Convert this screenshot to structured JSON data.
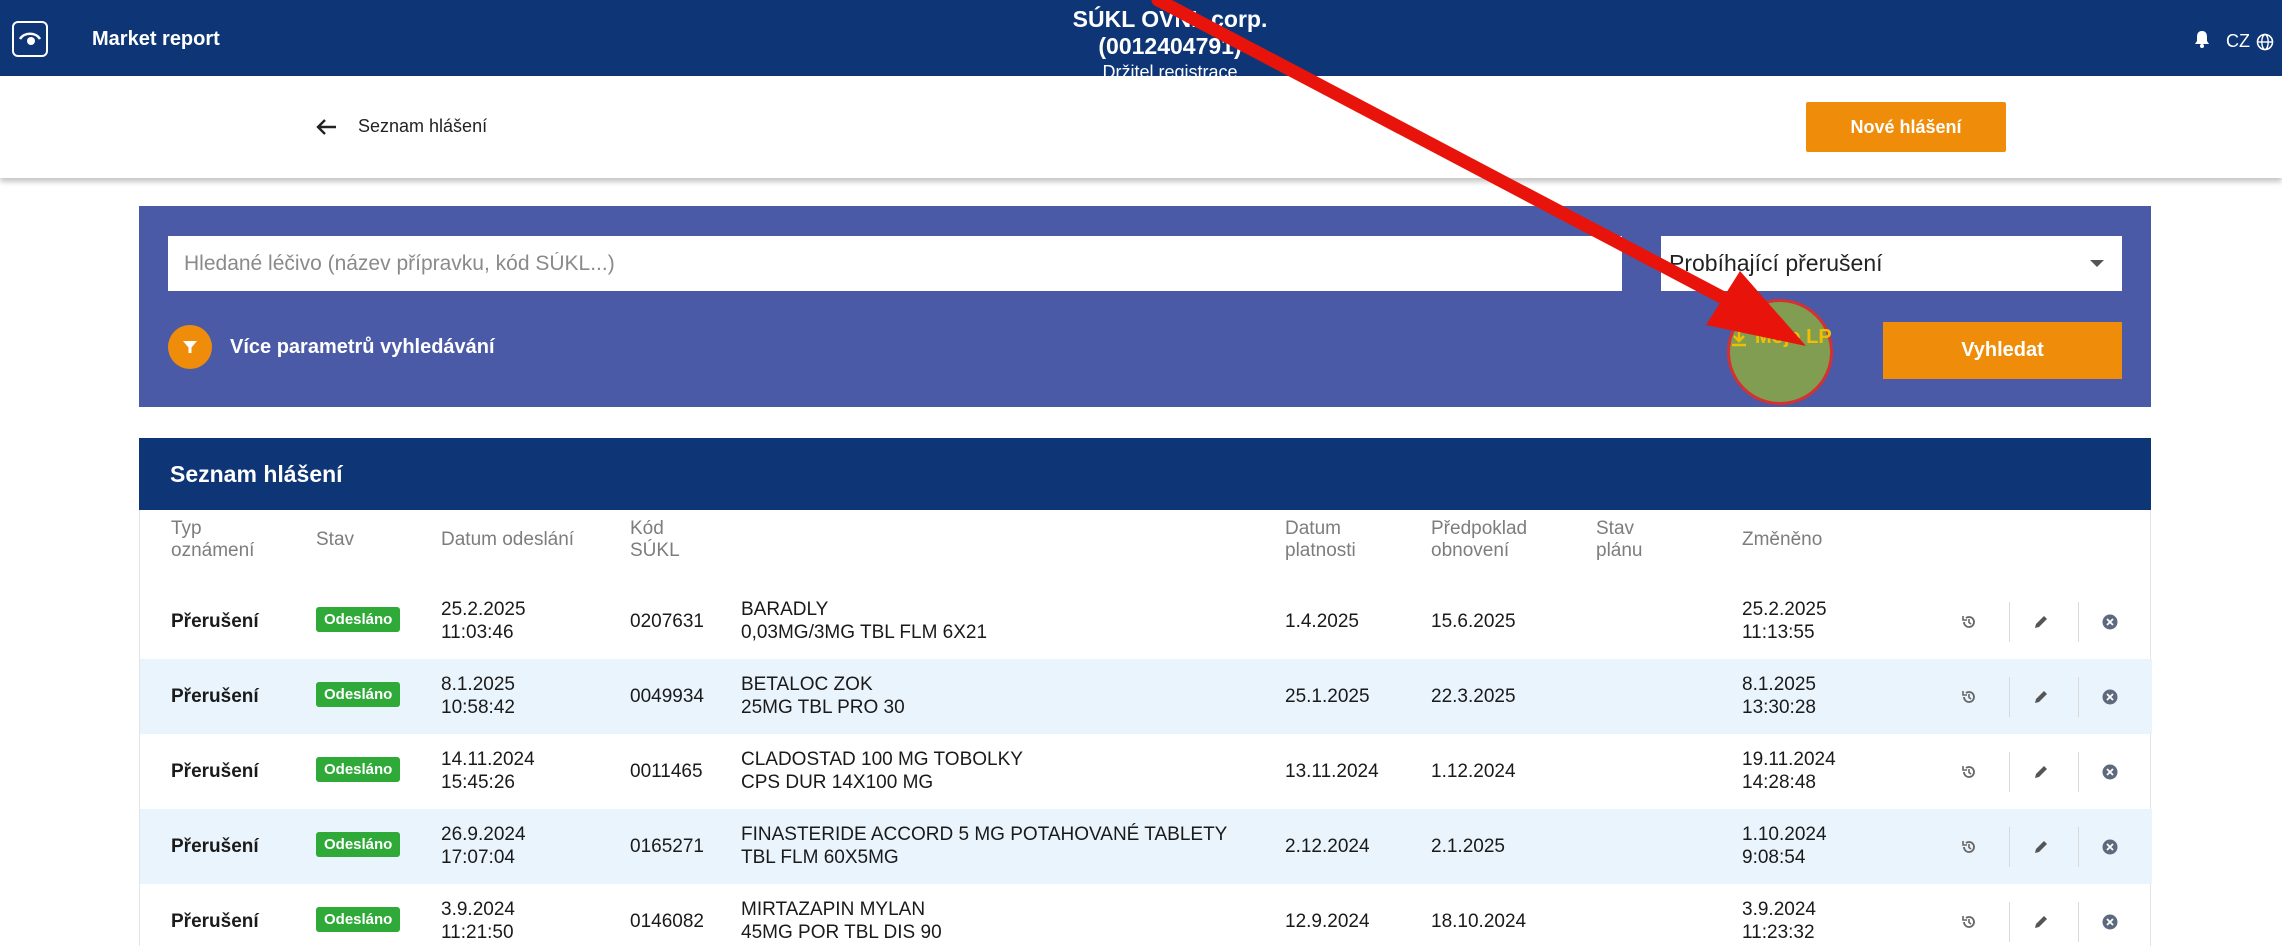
{
  "topbar": {
    "app_title": "Market report",
    "corp_name": "SÚKL OVNL corp. (0012404791)",
    "role": "Držitel registrace",
    "lang": "CZ"
  },
  "subheader": {
    "back_label": "Seznam hlášení",
    "new_report_label": "Nové hlášení"
  },
  "search": {
    "placeholder": "Hledané léčivo (název přípravku, kód SÚKL...)",
    "filter_selected": "Probíhající přerušení",
    "more_params_label": "Více parametrů vyhledávání",
    "moje_lp_label": "Moje LP",
    "search_button_label": "Vyhledat"
  },
  "list": {
    "title": "Seznam hlášení",
    "columns": {
      "type": [
        "Typ",
        "oznámení"
      ],
      "status": "Stav",
      "sent": "Datum odeslání",
      "code": [
        "Kód",
        "SÚKL"
      ],
      "valid": [
        "Datum",
        "platnosti"
      ],
      "renewal": [
        "Předpoklad",
        "obnovení"
      ],
      "plan": [
        "Stav",
        "plánu"
      ],
      "changed": "Změněno"
    },
    "rows": [
      {
        "type": "Přerušení",
        "status": "Odesláno",
        "sent_date": "25.2.2025",
        "sent_time": "11:03:46",
        "code": "0207631",
        "name": "BARADLY",
        "detail": "0,03MG/3MG TBL FLM 6X21",
        "valid": "1.4.2025",
        "renewal": "15.6.2025",
        "changed_date": "25.2.2025",
        "changed_time": "11:13:55"
      },
      {
        "type": "Přerušení",
        "status": "Odesláno",
        "sent_date": "8.1.2025",
        "sent_time": "10:58:42",
        "code": "0049934",
        "name": "BETALOC ZOK",
        "detail": "25MG TBL PRO 30",
        "valid": "25.1.2025",
        "renewal": "22.3.2025",
        "changed_date": "8.1.2025",
        "changed_time": "13:30:28"
      },
      {
        "type": "Přerušení",
        "status": "Odesláno",
        "sent_date": "14.11.2024",
        "sent_time": "15:45:26",
        "code": "0011465",
        "name": "CLADOSTAD 100 MG TOBOLKY",
        "detail": "CPS DUR 14X100 MG",
        "valid": "13.11.2024",
        "renewal": "1.12.2024",
        "changed_date": "19.11.2024",
        "changed_time": "14:28:48"
      },
      {
        "type": "Přerušení",
        "status": "Odesláno",
        "sent_date": "26.9.2024",
        "sent_time": "17:07:04",
        "code": "0165271",
        "name": "FINASTERIDE ACCORD 5 MG POTAHOVANÉ TABLETY",
        "detail": "TBL FLM 60X5MG",
        "valid": "2.12.2024",
        "renewal": "2.1.2025",
        "changed_date": "1.10.2024",
        "changed_time": "9:08:54"
      },
      {
        "type": "Přerušení",
        "status": "Odesláno",
        "sent_date": "3.9.2024",
        "sent_time": "11:21:50",
        "code": "0146082",
        "name": "MIRTAZAPIN MYLAN",
        "detail": "45MG POR TBL DIS 90",
        "valid": "12.9.2024",
        "renewal": "18.10.2024",
        "changed_date": "3.9.2024",
        "changed_time": "11:23:32"
      }
    ]
  },
  "colors": {
    "navy": "#0e3677",
    "panel": "#4a5aa7",
    "accent_orange": "#ef8d0b",
    "badge_green": "#2fa938",
    "row_alt": "#eaf4fd",
    "annotation_red": "#e8140c"
  },
  "icons": {
    "logo": "eye-logo-icon",
    "bell": "bell-icon",
    "globe": "globe-icon",
    "back": "arrow-left-icon",
    "filter": "filter-icon",
    "download": "download-icon",
    "history": "history-icon",
    "edit": "pencil-icon",
    "cancel": "close-circle-icon"
  }
}
